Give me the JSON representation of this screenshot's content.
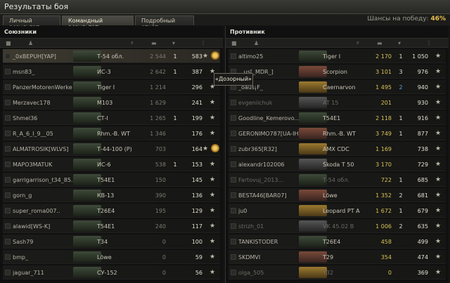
{
  "window": {
    "title": "Результаты боя"
  },
  "tabs": [
    "Личный результат",
    "Командный результат",
    "Подробный отчёт"
  ],
  "win_chance": {
    "label": "Шансы на победу:",
    "value": "46%"
  },
  "left_team": {
    "title": "Союзники",
    "rows": [
      {
        "name": "_0xBEPUH[YAP]",
        "vehicle": "Т-54 обл.",
        "damage": "2 544",
        "kills": "1",
        "exp": "583",
        "highlight": true,
        "badge": true
      },
      {
        "name": "msn83_",
        "vehicle": "ИС-3",
        "damage": "2 642",
        "kills": "1",
        "exp": "387",
        "highlight": false,
        "badge": false
      },
      {
        "name": "PanzerMotorenWerke",
        "vehicle": "Tiger I",
        "damage": "1 214",
        "kills": "",
        "exp": "296",
        "highlight": false,
        "badge": false
      },
      {
        "name": "Merzavec178",
        "vehicle": "M103",
        "damage": "1 629",
        "kills": "",
        "exp": "241",
        "highlight": false,
        "badge": false
      },
      {
        "name": "Shmel36",
        "vehicle": "СТ-I",
        "damage": "1 265",
        "kills": "1",
        "exp": "199",
        "highlight": false,
        "badge": false
      },
      {
        "name": "R_A_6_I_9__05",
        "vehicle": "Rhm.-B. WT",
        "damage": "1 346",
        "kills": "",
        "exp": "176",
        "highlight": false,
        "badge": false
      },
      {
        "name": "ALMATROSIK[WLVS]",
        "vehicle": "Т-44-100 (Р)",
        "damage": "703",
        "kills": "",
        "exp": "164",
        "highlight": false,
        "badge": true
      },
      {
        "name": "MAPO3MATUK",
        "vehicle": "ИС-6",
        "damage": "538",
        "kills": "1",
        "exp": "153",
        "highlight": false,
        "badge": false
      },
      {
        "name": "garrigarrison_t34_85...",
        "vehicle": "T54E1",
        "damage": "150",
        "kills": "",
        "exp": "145",
        "highlight": false,
        "badge": false
      },
      {
        "name": "gorn_g",
        "vehicle": "КВ-13",
        "damage": "390",
        "kills": "",
        "exp": "136",
        "highlight": false,
        "badge": false
      },
      {
        "name": "super_roma007..",
        "vehicle": "T26E4",
        "damage": "195",
        "kills": "",
        "exp": "129",
        "highlight": false,
        "badge": false
      },
      {
        "name": "alawid[WS-K]",
        "vehicle": "T54E1",
        "damage": "240",
        "kills": "",
        "exp": "117",
        "highlight": false,
        "badge": false
      },
      {
        "name": "Sash79",
        "vehicle": "T34",
        "damage": "0",
        "kills": "",
        "exp": "100",
        "highlight": false,
        "badge": false
      },
      {
        "name": "bmp_",
        "vehicle": "Löwe",
        "damage": "0",
        "kills": "",
        "exp": "59",
        "highlight": false,
        "badge": false
      },
      {
        "name": "jaguar_711",
        "vehicle": "СУ-152",
        "damage": "0",
        "kills": "",
        "exp": "56",
        "highlight": false,
        "badge": false
      }
    ]
  },
  "right_team": {
    "title": "Противник",
    "rows": [
      {
        "name": "altimo25",
        "vehicle": "Tiger I",
        "damage": "2 170",
        "kills": "1",
        "exp": "1 050",
        "dead": false,
        "blue_kills": false
      },
      {
        "name": "...us[_MDR_]",
        "vehicle": "Scorpion",
        "damage": "3 101",
        "kills": "3",
        "exp": "976",
        "dead": false,
        "blue_kills": false
      },
      {
        "name": "_oaus¡F_",
        "vehicle": "Caernarvon",
        "damage": "1 495",
        "kills": "2",
        "exp": "940",
        "dead": false,
        "blue_kills": true
      },
      {
        "name": "evgeniichuk",
        "vehicle": "AT 15",
        "damage": "201",
        "kills": "",
        "exp": "930",
        "dead": true,
        "blue_kills": false
      },
      {
        "name": "Goodline_Kemerovo...",
        "vehicle": "T54E1",
        "damage": "2 118",
        "kills": "1",
        "exp": "916",
        "dead": false,
        "blue_kills": false
      },
      {
        "name": "GERONIMO787[UA-IH]",
        "vehicle": "Rhm.-B. WT",
        "damage": "3 749",
        "kills": "1",
        "exp": "877",
        "dead": false,
        "blue_kills": false
      },
      {
        "name": "zubr365[R32]",
        "vehicle": "AMX CDC",
        "damage": "1 169",
        "kills": "",
        "exp": "738",
        "dead": false,
        "blue_kills": false
      },
      {
        "name": "alexandr102006",
        "vehicle": "Škoda T 50",
        "damage": "3 170",
        "kills": "",
        "exp": "729",
        "dead": false,
        "blue_kills": false
      },
      {
        "name": "Fartovuj_2013...",
        "vehicle": "Т-54 обл.",
        "damage": "722",
        "kills": "1",
        "exp": "685",
        "dead": true,
        "blue_kills": false
      },
      {
        "name": "BESTA46[BAR07]",
        "vehicle": "Löwe",
        "damage": "1 352",
        "kills": "2",
        "exp": "681",
        "dead": false,
        "blue_kills": false
      },
      {
        "name": "ju0",
        "vehicle": "Leopard PT A",
        "damage": "1 672",
        "kills": "1",
        "exp": "679",
        "dead": false,
        "blue_kills": false
      },
      {
        "name": "strizh_01",
        "vehicle": "VK 45.02 B",
        "damage": "1 006",
        "kills": "2",
        "exp": "635",
        "dead": true,
        "blue_kills": false
      },
      {
        "name": "TANKISTODER",
        "vehicle": "T26E4",
        "damage": "458",
        "kills": "",
        "exp": "499",
        "dead": false,
        "blue_kills": false
      },
      {
        "name": "SKDMVI",
        "vehicle": "T29",
        "damage": "354",
        "kills": "",
        "exp": "474",
        "dead": false,
        "blue_kills": false
      },
      {
        "name": "olga_505",
        "vehicle": "T32",
        "damage": "0",
        "kills": "",
        "exp": "369",
        "dead": true,
        "blue_kills": false
      }
    ]
  },
  "tooltip": {
    "text": "«Дозорный»"
  },
  "colors": {
    "accent": "#e8c04e",
    "damage_yellow": "#d8c356",
    "kills_blue": "#5aa0e0"
  },
  "icons": {
    "star": "★",
    "header": [
      "squad-icon",
      "player-icon",
      "vehicle-icon",
      "damage-icon",
      "kills-icon",
      "exp-icon"
    ]
  }
}
